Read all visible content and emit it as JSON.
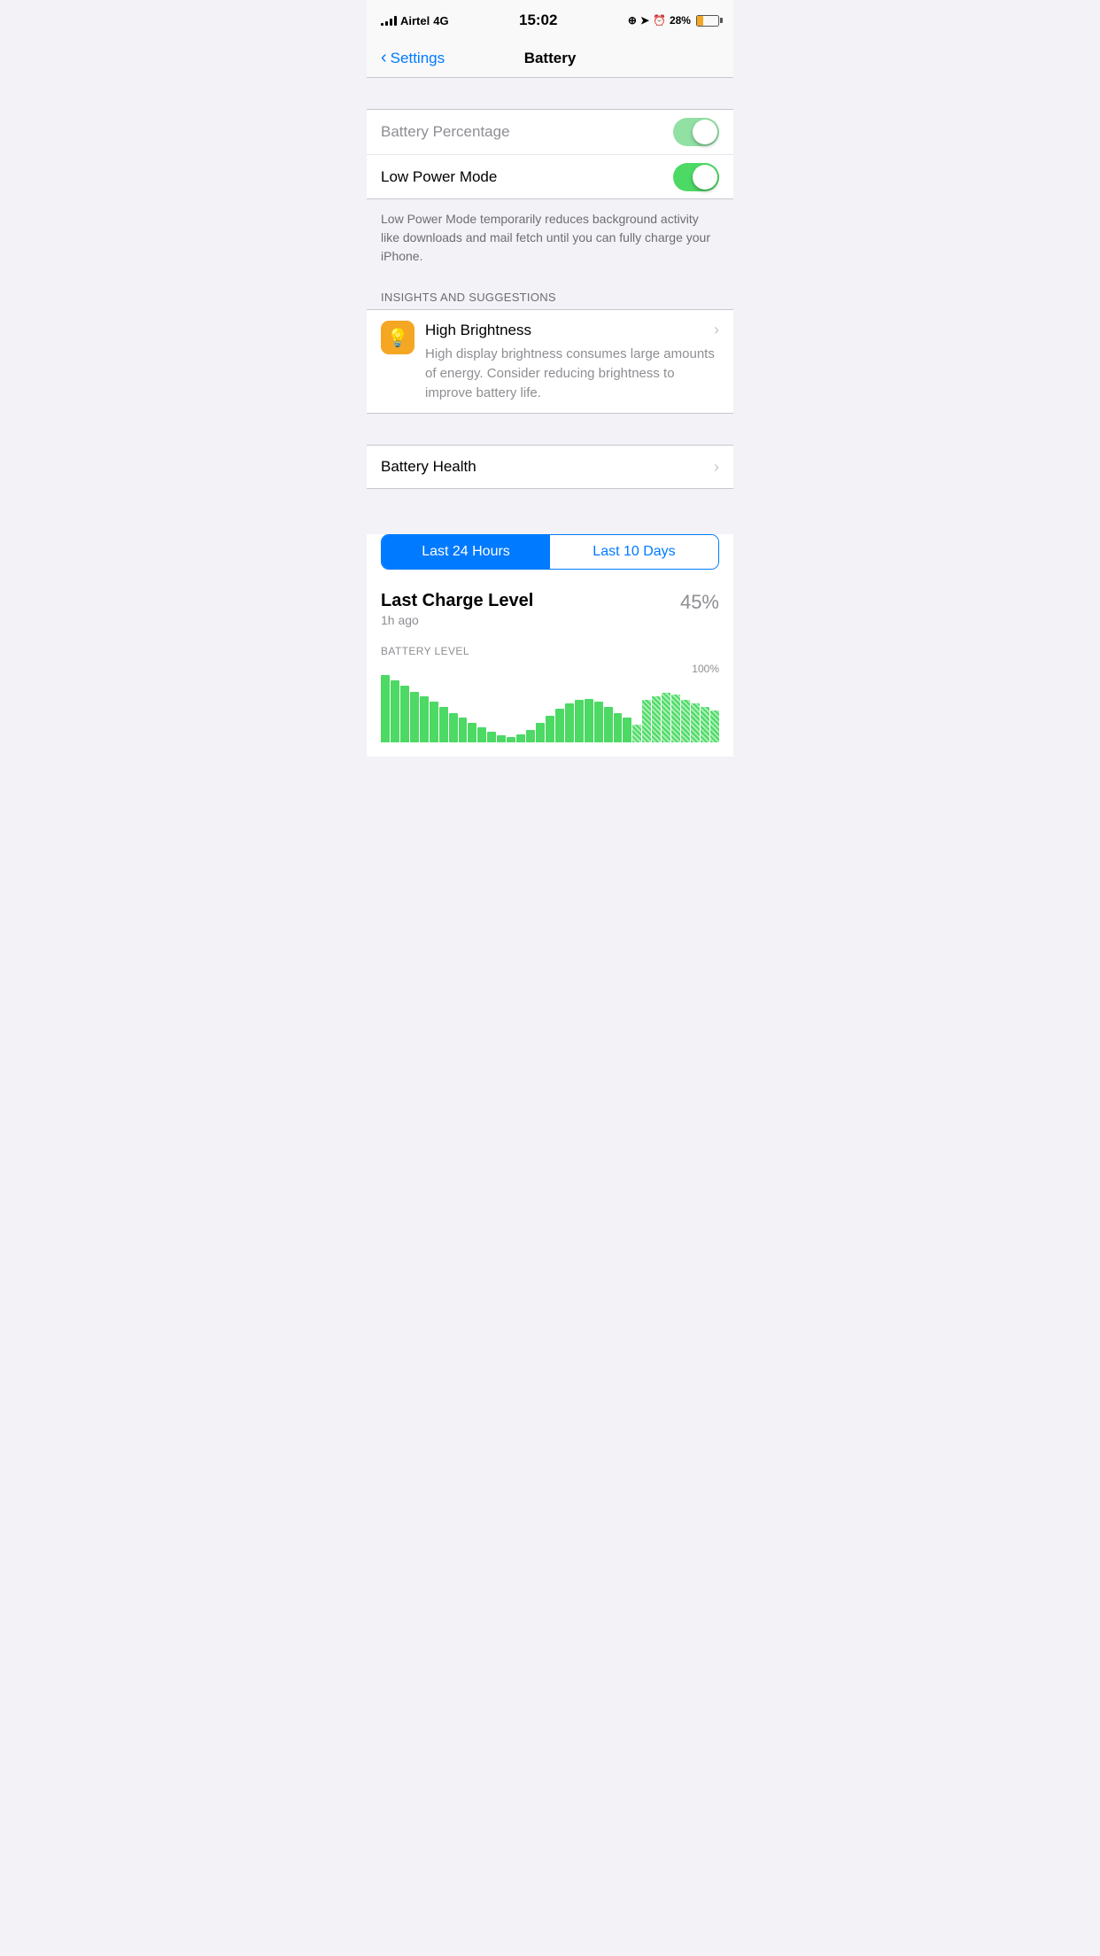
{
  "statusBar": {
    "carrier": "Airtel",
    "network": "4G",
    "time": "15:02",
    "batteryPercent": "28%"
  },
  "nav": {
    "back": "Settings",
    "title": "Battery"
  },
  "settings": {
    "batteryPercentage": {
      "label": "Battery Percentage",
      "enabled": true
    },
    "lowPowerMode": {
      "label": "Low Power Mode",
      "enabled": true
    },
    "lowPowerDescription": "Low Power Mode temporarily reduces background activity like downloads and mail fetch until you can fully charge your iPhone."
  },
  "insightsSection": {
    "header": "INSIGHTS AND SUGGESTIONS",
    "items": [
      {
        "title": "High Brightness",
        "description": "High display brightness consumes large amounts of energy. Consider reducing brightness to improve battery life."
      }
    ]
  },
  "batteryHealth": {
    "label": "Battery Health"
  },
  "timeSelector": {
    "option1": "Last 24 Hours",
    "option2": "Last 10 Days",
    "activeIndex": 0
  },
  "lastCharge": {
    "title": "Last Charge Level",
    "timeAgo": "1h ago",
    "percent": "45%"
  },
  "batteryLevelChart": {
    "label": "BATTERY LEVEL",
    "percentLabel": "100%",
    "bars": [
      95,
      88,
      80,
      72,
      65,
      58,
      50,
      42,
      35,
      28,
      22,
      15,
      10,
      8,
      12,
      18,
      28,
      38,
      48,
      55,
      60,
      62,
      58,
      50,
      42,
      35,
      25,
      60,
      65,
      70,
      68,
      60,
      55,
      50,
      45
    ],
    "stripedStart": 26
  }
}
